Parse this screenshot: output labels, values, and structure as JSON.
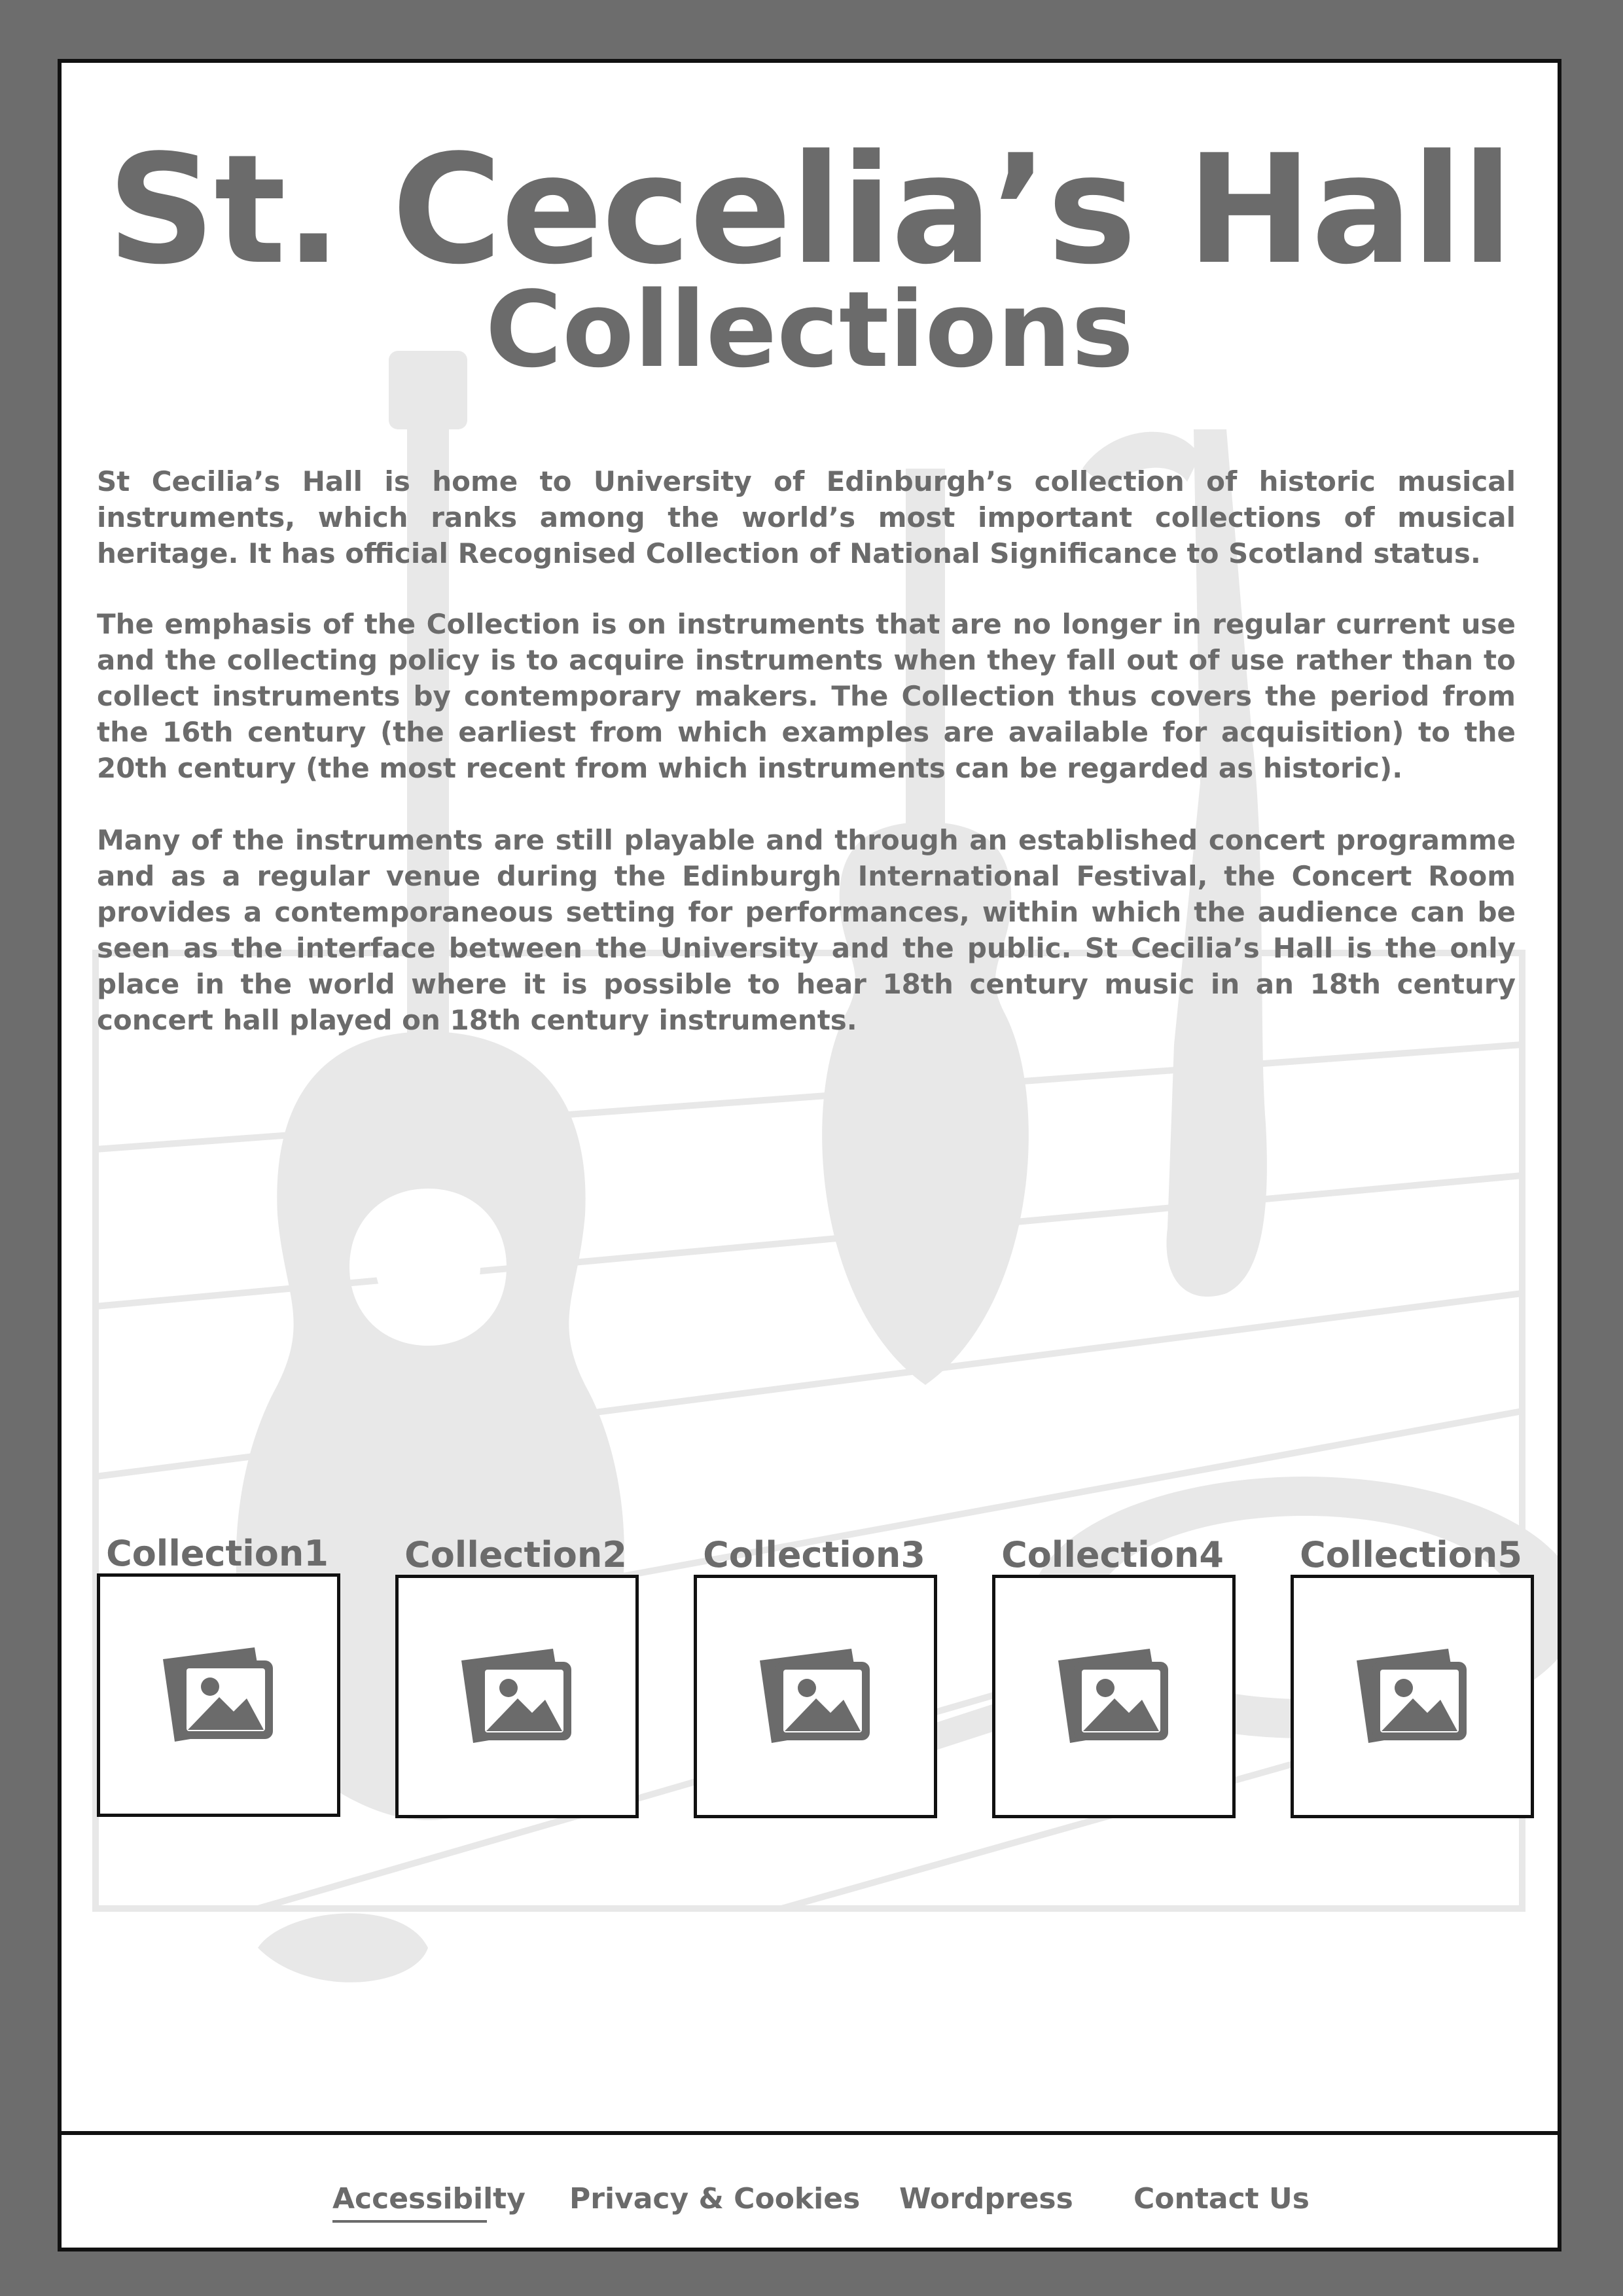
{
  "header": {
    "title": "St. Cecelia’s Hall",
    "subtitle": "Collections"
  },
  "intro": {
    "p1": "St Cecilia’s Hall is home to University of Edinburgh’s collection of historic musical instruments, which ranks among the world’s most important collections of musical heritage. It has official Recognised Collection of National Significance to Scotland status.",
    "p2": "The emphasis of the Collection is on instruments that are no longer in regular current use and the collecting policy is to acquire instruments when they fall out of use rather than to collect instruments by contemporary makers. The Collection thus covers the period from the 16th century (the earliest from which examples are available for acquisition) to the 20th century (the most recent from which instruments can be regarded as historic).",
    "p3": "Many of the instruments are still playable and through an established concert programme and as a regular venue during the Edinburgh International Festival, the Concert Room provides a contemporaneous setting for performances, within which the audience can be seen as the interface between the University and the public. St Cecilia’s Hall is the only place in the world where it is possible to hear 18th century music in an 18th century concert hall played on 18th century instruments."
  },
  "collections": [
    {
      "label": "Collection1",
      "icon": "image-placeholder-icon"
    },
    {
      "label": "Collection2",
      "icon": "image-placeholder-icon"
    },
    {
      "label": "Collection3",
      "icon": "image-placeholder-icon"
    },
    {
      "label": "Collection4",
      "icon": "image-placeholder-icon"
    },
    {
      "label": "Collection5",
      "icon": "image-placeholder-icon"
    }
  ],
  "footer": {
    "links": [
      "Accessibilty",
      "Privacy & Cookies",
      "Wordpress",
      "Contact Us"
    ],
    "active": "Accessibilty"
  },
  "colors": {
    "page_background": "#6d6d6d",
    "text": "#6b6b6b",
    "background_art": "#e8e8e8",
    "border": "#111111"
  }
}
